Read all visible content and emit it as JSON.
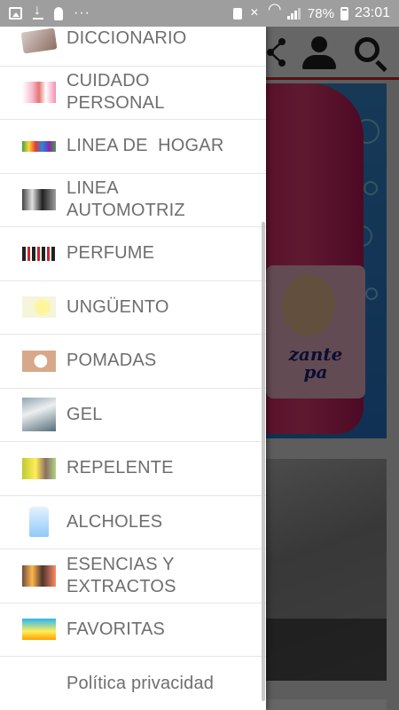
{
  "status_bar": {
    "dots": "···",
    "battery_percent": "78%",
    "time": "23:01",
    "left_icons": [
      "gallery-icon",
      "download-icon",
      "notification-icon",
      "more-dots"
    ],
    "right_icons": [
      "lock-icon",
      "mute-icon",
      "wifi-icon",
      "signal-icon",
      "battery-icon"
    ]
  },
  "app": {
    "toolbar_icons": [
      "share-icon",
      "account-icon",
      "search-icon"
    ],
    "accent_color": "#d32f2f",
    "banner_text": "…zante pa",
    "banner_text_lines": [
      "zante",
      "pa"
    ]
  },
  "drawer": {
    "items": [
      {
        "label": "DICCIONARIO",
        "icon": "dictionary-thumb"
      },
      {
        "label": "CUIDADO PERSONAL",
        "icon": "personal-care-thumb"
      },
      {
        "label": "LINEA DE  HOGAR",
        "icon": "home-line-thumb"
      },
      {
        "label": "LINEA AUTOMOTRIZ",
        "icon": "automotive-thumb"
      },
      {
        "label": "PERFUME",
        "icon": "perfume-thumb"
      },
      {
        "label": "UNGÜENTO",
        "icon": "ointment-thumb"
      },
      {
        "label": "POMADAS",
        "icon": "pomade-thumb"
      },
      {
        "label": "GEL",
        "icon": "gel-thumb"
      },
      {
        "label": "REPELENTE",
        "icon": "repellent-thumb"
      },
      {
        "label": "ALCHOLES",
        "icon": "alcohol-thumb"
      },
      {
        "label": "ESENCIAS Y EXTRACTOS",
        "icon": "essences-thumb"
      },
      {
        "label": "FAVORITAS",
        "icon": "favorites-thumb"
      },
      {
        "label": "Política privacidad",
        "icon": ""
      }
    ]
  }
}
